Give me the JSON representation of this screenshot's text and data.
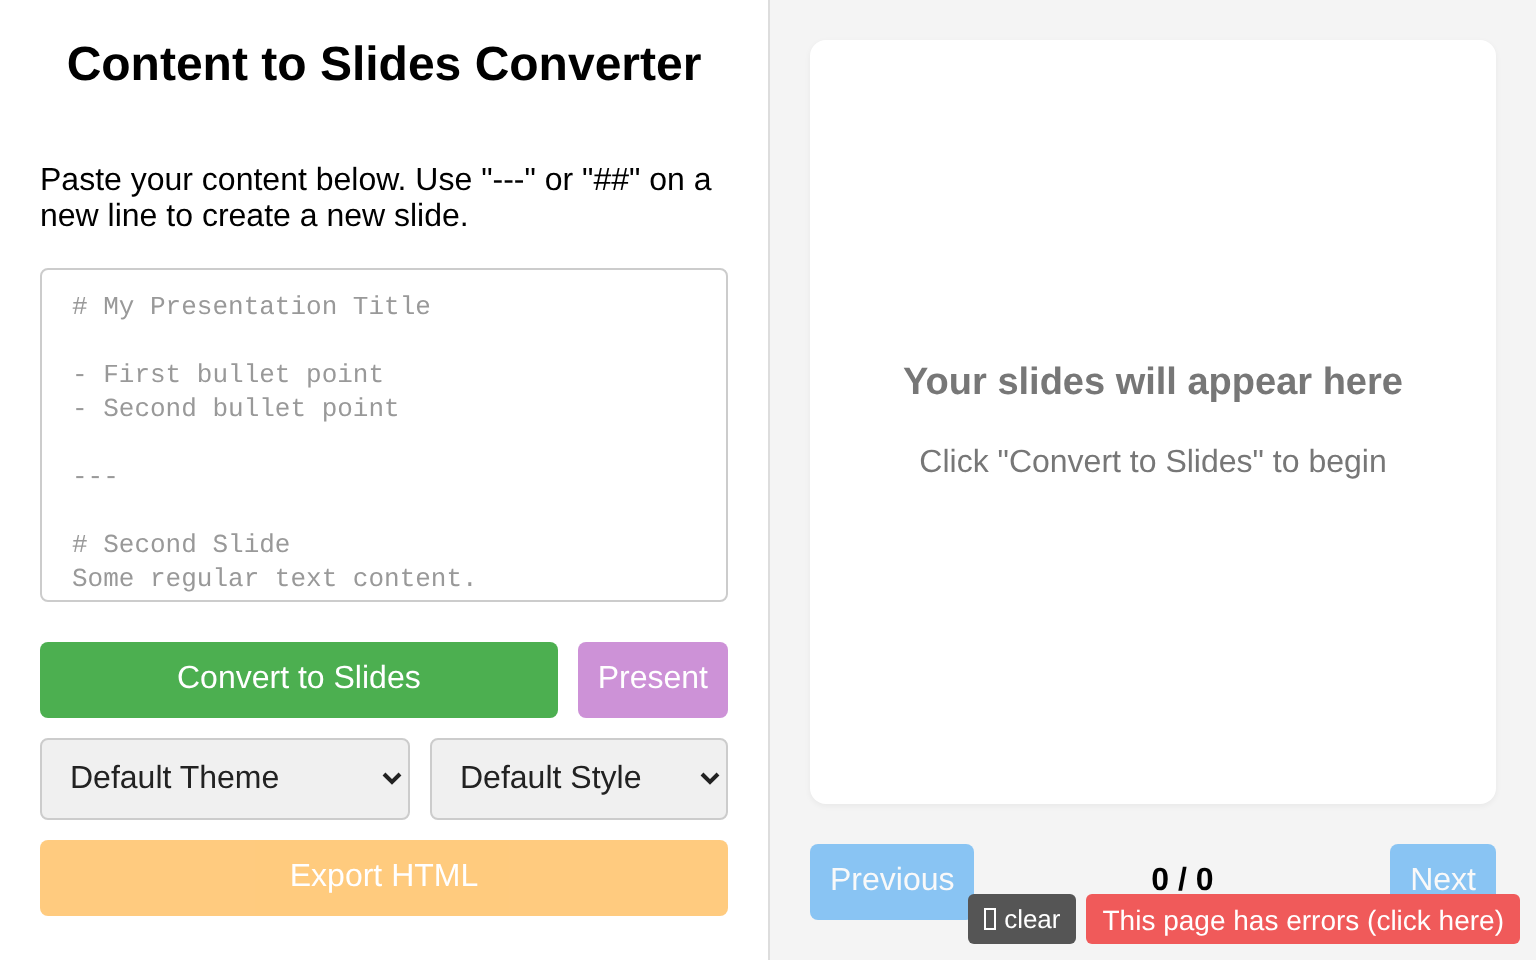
{
  "title": "Content to Slides Converter",
  "instructions": "Paste your content below. Use \"---\" or \"##\" on a new line to create a new slide.",
  "editor": {
    "placeholder": "# My Presentation Title\n\n- First bullet point\n- Second bullet point\n\n---\n\n# Second Slide\nSome regular text content."
  },
  "actions": [
    {
      "label": "Convert to Slides",
      "kind": "convert",
      "disabled": false
    },
    {
      "label": "Present",
      "kind": "present",
      "disabled": true
    }
  ],
  "selects": [
    {
      "value": "Default Theme"
    },
    {
      "value": "Default Style"
    }
  ],
  "export": {
    "label": "Export HTML",
    "disabled": true
  },
  "preview": {
    "heading": "Your slides will appear here",
    "hint": "Click \"Convert to Slides\" to begin"
  },
  "nav": {
    "previous": {
      "label": "Previous",
      "disabled": true
    },
    "counter": "0 / 0",
    "next": {
      "label": "Next",
      "disabled": true
    }
  },
  "overlay": {
    "clear": "clear",
    "error": "This page has errors (click here)"
  }
}
